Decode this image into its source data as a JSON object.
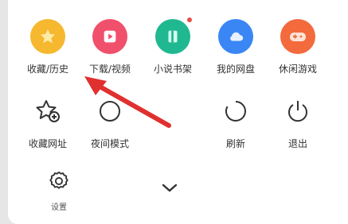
{
  "row1": [
    {
      "label": "收藏/历史",
      "icon": "star-icon",
      "color": "#f5b82e"
    },
    {
      "label": "下载/视频",
      "icon": "play-icon",
      "color": "#f0506b"
    },
    {
      "label": "小说书架",
      "icon": "book-icon",
      "color": "#20b890"
    },
    {
      "label": "我的网盘",
      "icon": "cloud-icon",
      "color": "#3a86f5"
    },
    {
      "label": "休闲游戏",
      "icon": "gamepad-icon",
      "color": "#f36a3d"
    }
  ],
  "row2": [
    {
      "label": "收藏网址",
      "icon": "star-add-icon"
    },
    {
      "label": "夜间模式",
      "icon": "night-mode-icon"
    },
    {
      "label": "刷新",
      "icon": "refresh-icon"
    },
    {
      "label": "退出",
      "icon": "power-icon"
    }
  ],
  "settings": {
    "label": "设置"
  },
  "colors": {
    "accent_arrow": "#e03030",
    "icon_outline": "#333333"
  }
}
